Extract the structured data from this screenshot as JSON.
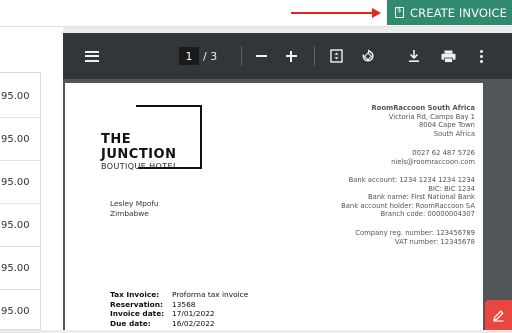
{
  "header": {
    "create_invoice_label": "CREATE INVOICE",
    "create_invoice_icon": "invoice-document-icon",
    "accent_color": "#2f8a70",
    "annotation_arrow_color": "#e0281c"
  },
  "left_table": {
    "amounts": [
      "95.00",
      "95.00",
      "95.00",
      "95.00",
      "95.00",
      "95.00"
    ]
  },
  "pdf_viewer": {
    "current_page": "1",
    "total_pages": "/ 3",
    "toolbar_icons": [
      "menu-icon",
      "zoom-out-icon",
      "zoom-in-icon",
      "fit-page-icon",
      "rotate-icon",
      "download-icon",
      "print-icon",
      "more-vert-icon"
    ],
    "document": {
      "logo": {
        "line1": "THE",
        "line2": "JUNCTION",
        "sub": "BOUTIQUE HOTEL"
      },
      "company": {
        "name": "RoomRaccoon South Africa",
        "address1": "Victoria Rd, Camps Bay 1",
        "address2": "8004 Cape Town",
        "country": "South Africa",
        "phone": "0027 62 487 5726",
        "email": "niels@roomraccoon.com",
        "bank_account": "Bank account: 1234 1234 1234 1234",
        "bic": "BIC: BIC 1234",
        "bank_name": "Bank name: First National Bank",
        "bank_holder": "Bank account holder: RoomRaccoon SA",
        "branch_code": "Branch code: 00000004307",
        "company_reg": "Company reg. number: 123456789",
        "vat": "VAT number: 12345678"
      },
      "customer": {
        "name": "Lesley Mpofu",
        "country": "Zimbabwe"
      },
      "meta": {
        "tax_invoice_label": "Tax Invoice:",
        "tax_invoice_value": "Proforma tax invoice",
        "reservation_label": "Reservation:",
        "reservation_value": "13568",
        "invoice_date_label": "Invoice date:",
        "invoice_date_value": "17/01/2022",
        "due_date_label": "Due date:",
        "due_date_value": "16/02/2022"
      }
    }
  },
  "fab": {
    "icon": "edit-pencil-icon",
    "color": "#e8473e"
  }
}
